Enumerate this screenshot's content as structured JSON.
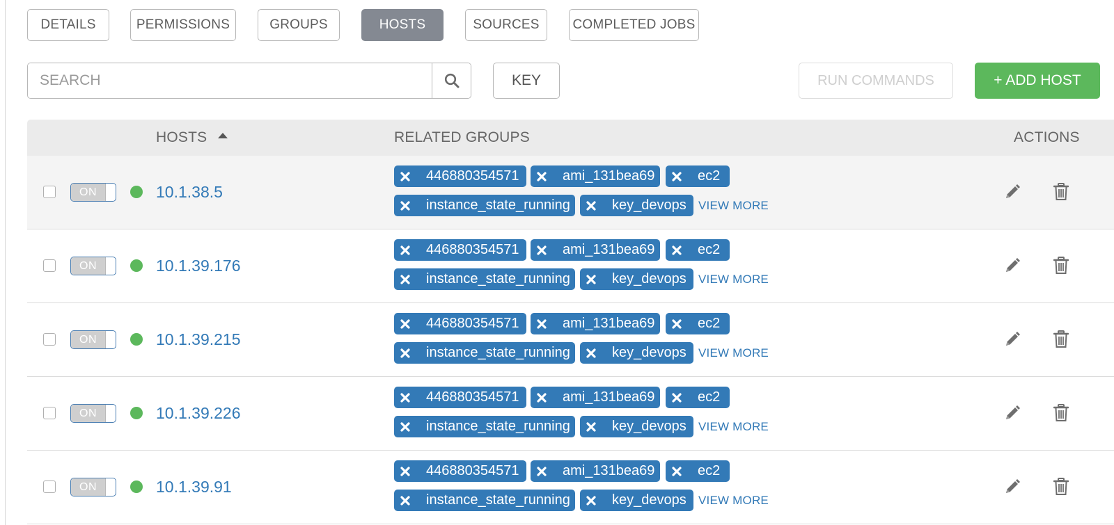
{
  "tabs": [
    {
      "label": "DETAILS",
      "active": false
    },
    {
      "label": "PERMISSIONS",
      "active": false
    },
    {
      "label": "GROUPS",
      "active": false
    },
    {
      "label": "HOSTS",
      "active": true
    },
    {
      "label": "SOURCES",
      "active": false
    },
    {
      "label": "COMPLETED JOBS",
      "active": false
    }
  ],
  "toolbar": {
    "search_placeholder": "SEARCH",
    "search_icon": "search-icon",
    "key_label": "KEY",
    "run_commands_label": "RUN COMMANDS",
    "add_host_label": "+ ADD HOST"
  },
  "table": {
    "headers": {
      "hosts": "HOSTS",
      "related_groups": "RELATED GROUPS",
      "actions": "ACTIONS"
    },
    "rows": [
      {
        "toggle": "ON",
        "status": "active",
        "host": "10.1.38.5",
        "groups": [
          "446880354571",
          "ami_131bea69",
          "ec2",
          "instance_state_running",
          "key_devops"
        ],
        "view_more": "VIEW MORE"
      },
      {
        "toggle": "ON",
        "status": "active",
        "host": "10.1.39.176",
        "groups": [
          "446880354571",
          "ami_131bea69",
          "ec2",
          "instance_state_running",
          "key_devops"
        ],
        "view_more": "VIEW MORE"
      },
      {
        "toggle": "ON",
        "status": "active",
        "host": "10.1.39.215",
        "groups": [
          "446880354571",
          "ami_131bea69",
          "ec2",
          "instance_state_running",
          "key_devops"
        ],
        "view_more": "VIEW MORE"
      },
      {
        "toggle": "ON",
        "status": "active",
        "host": "10.1.39.226",
        "groups": [
          "446880354571",
          "ami_131bea69",
          "ec2",
          "instance_state_running",
          "key_devops"
        ],
        "view_more": "VIEW MORE"
      },
      {
        "toggle": "ON",
        "status": "active",
        "host": "10.1.39.91",
        "groups": [
          "446880354571",
          "ami_131bea69",
          "ec2",
          "instance_state_running",
          "key_devops"
        ],
        "view_more": "VIEW MORE"
      }
    ]
  },
  "colors": {
    "accent_blue": "#337ab7",
    "success_green": "#5cb85c",
    "active_tab": "#848992",
    "header_bg": "#ebebeb"
  },
  "icons": {
    "edit": "pencil-icon",
    "delete": "trash-icon",
    "tag_remove": "close-icon",
    "sort": "sort-ascending-icon"
  }
}
